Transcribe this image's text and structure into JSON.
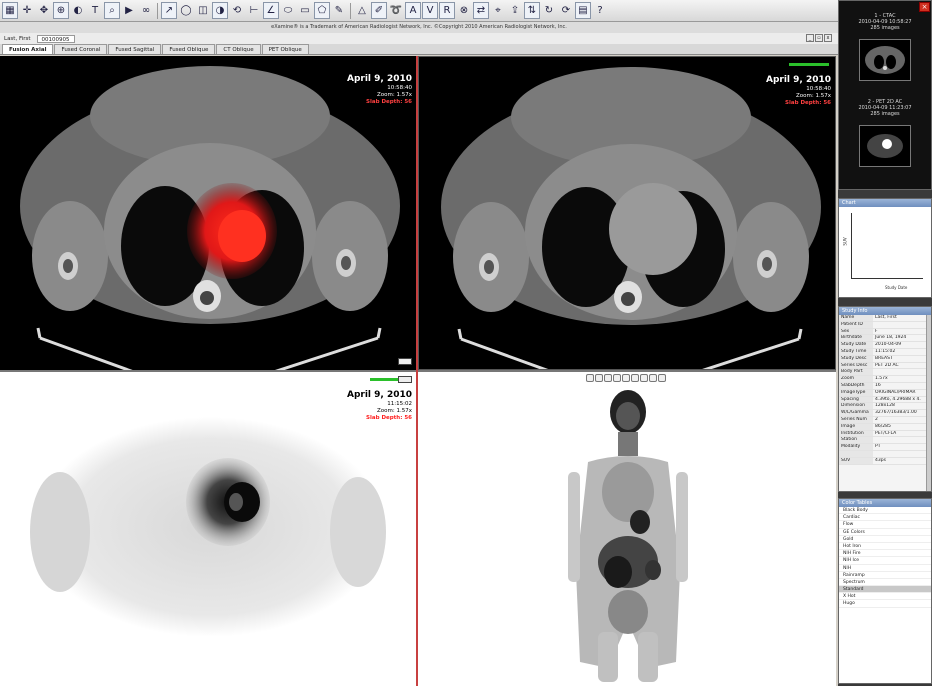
{
  "toolbar": {
    "icons": [
      "grid-layout-icon",
      "crosshair-icon",
      "pan-icon",
      "zoom-icon",
      "window-level-icon",
      "text-annotation-icon",
      "magnify-icon",
      "cine-icon",
      "link-icon",
      "arrow-icon",
      "roi-icon",
      "hide-overlay-icon",
      "invert-icon",
      "reset-icon",
      "ruler-icon",
      "angle-icon",
      "ellipse-icon",
      "rectangle-icon",
      "polygon-icon",
      "freehand-icon",
      "triangle-icon",
      "brush-icon",
      "lasso-icon",
      "fusion-icon",
      "swap-icon",
      "registration-icon",
      "export-icon",
      "flip-icon",
      "rotate-icon",
      "sync-icon",
      "tile-icon",
      "help-icon"
    ],
    "letter_buttons": [
      "A",
      "V",
      "R"
    ]
  },
  "notice": "eXamine® is a Trademark of American Radiologist Network, Inc. ©Copyright 2010 American Radiologist Network, Inc.",
  "patient": {
    "name": "Last, First",
    "id": "00100905"
  },
  "tabs": [
    {
      "label": "Fusion Axial",
      "active": true
    },
    {
      "label": "Fused Coronal",
      "active": false
    },
    {
      "label": "Fused Sagittal",
      "active": false
    },
    {
      "label": "Fused Oblique",
      "active": false
    },
    {
      "label": "CT Oblique",
      "active": false
    },
    {
      "label": "PET Oblique",
      "active": false
    }
  ],
  "viewports": {
    "fused": {
      "date": "April 9, 2010",
      "time": "10:58:40",
      "zoom": "Zoom: 1.57x",
      "depth": "Slab Depth: 56"
    },
    "ct": {
      "date": "April 9, 2010",
      "time": "10:58:40",
      "zoom": "Zoom: 1.57x",
      "depth": "Slab Depth: 56"
    },
    "pet": {
      "date": "April 9, 2010",
      "time": "11:15:02",
      "zoom": "Zoom: 1.57x",
      "depth": "Slab Depth: 56"
    }
  },
  "series": [
    {
      "title": "1 - CTAC",
      "datetime": "2010-04-09 10:58:27",
      "count": "285 images"
    },
    {
      "title": "2 - PET 2D AC",
      "datetime": "2010-04-09 11:23:07",
      "count": "285 images"
    }
  ],
  "study_pane": {
    "title": "Chart",
    "ylabel": "SUV",
    "xlabel": "Study Date"
  },
  "info_pane": {
    "title": "Study Info",
    "rows": [
      {
        "k": "Name",
        "v": "Last, First"
      },
      {
        "k": "Patient ID",
        "v": ""
      },
      {
        "k": "Sex",
        "v": "F"
      },
      {
        "k": "Birthdate",
        "v": "June 18, 1924"
      },
      {
        "k": "Study Date",
        "v": "2010-04-09"
      },
      {
        "k": "Study Time",
        "v": "11:15:02"
      },
      {
        "k": "Study Desc",
        "v": "BREAST"
      },
      {
        "k": "Series Desc",
        "v": "PET 2D AC"
      },
      {
        "k": "Body Part",
        "v": ""
      },
      {
        "k": "Zoom",
        "v": "1.57x"
      },
      {
        "k": "SlabDepth",
        "v": "16"
      },
      {
        "k": "ImageType",
        "v": "ORIGINAL\\PRIMAR"
      },
      {
        "k": "Spacing",
        "v": "4.39to, 4.29688 x 4."
      },
      {
        "k": "Dimension",
        "v": "128x128"
      },
      {
        "k": "W/L/Gamma",
        "v": "32767/16383/1.00"
      },
      {
        "k": "Series Num",
        "v": "2"
      },
      {
        "k": "Image",
        "v": "86/285"
      },
      {
        "k": "Institution",
        "v": "PET/CFLA"
      },
      {
        "k": "Station",
        "v": ""
      },
      {
        "k": "Modality",
        "v": "PT"
      },
      {
        "k": "",
        "v": ""
      },
      {
        "k": "SUV",
        "v": "43ps"
      }
    ]
  },
  "lut_pane": {
    "title": "Color Tables",
    "items": [
      "Black Body",
      "Cardiac",
      "Flow",
      "GE Colors",
      "Gold",
      "Hot Iron",
      "NIH Fire",
      "NIH Ice",
      "NIH",
      "Rainramp",
      "Spectrum",
      "Standard",
      "X Hot",
      "Hugo"
    ],
    "selected": "Standard"
  },
  "colors": {
    "accent_green": "#2bc02b",
    "red_text": "#ff4040",
    "pane_title": "#6f8fbe"
  }
}
